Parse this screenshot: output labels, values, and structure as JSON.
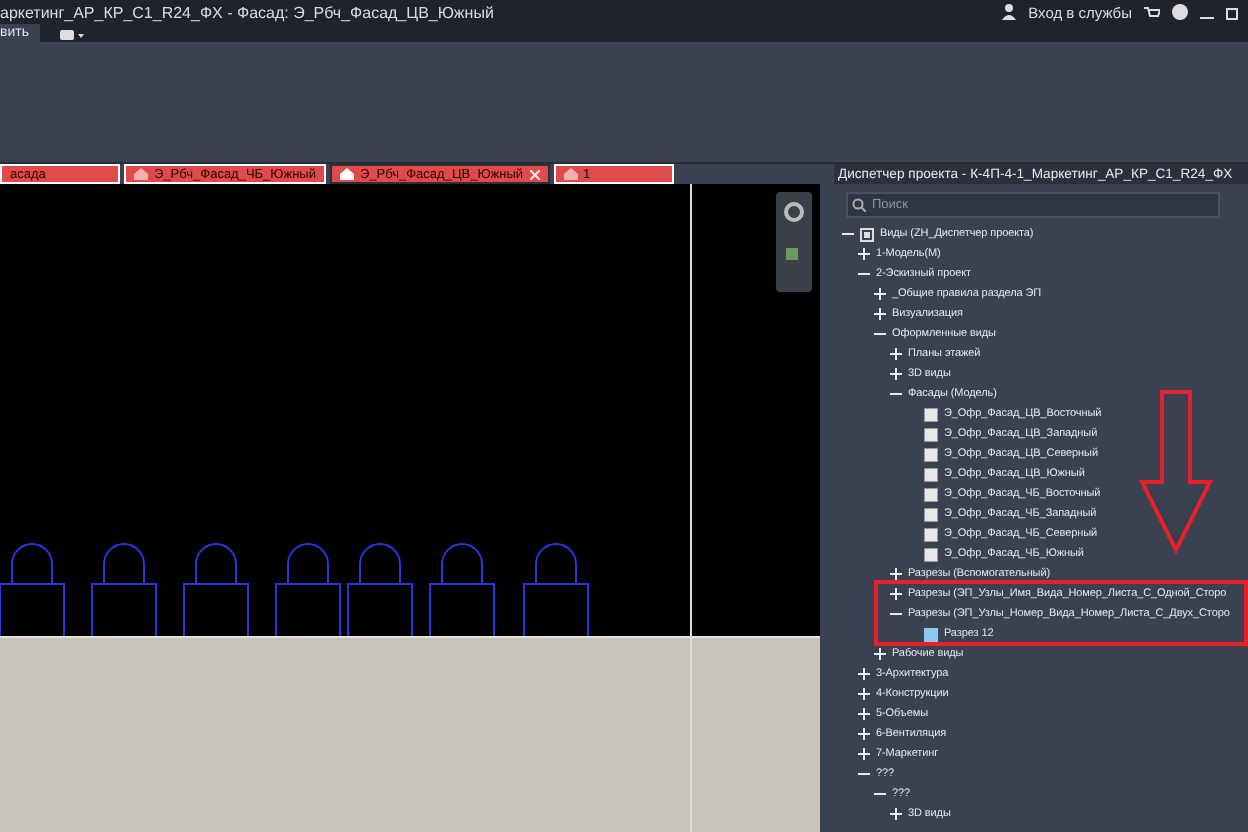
{
  "window": {
    "title": "аркетинг_АР_КР_С1_R24_ФХ - Фасад: Э_Рбч_Фасад_ЦВ_Южный",
    "signin": "Вход в службы"
  },
  "ribbon": {
    "tabs": [
      {
        "label": "вить",
        "selected": true
      }
    ]
  },
  "doc_tabs": [
    {
      "label": "асада",
      "selected": false,
      "icon": false
    },
    {
      "label": "Э_Рбч_Фасад_ЧБ_Южный",
      "selected": false,
      "icon": true
    },
    {
      "label": "Э_Рбч_Фасад_ЦВ_Южный",
      "selected": true,
      "icon": true
    },
    {
      "label": "1",
      "selected": false,
      "icon": true
    }
  ],
  "project_browser": {
    "title": "Диспетчер проекта - К-4П-4-1_Маркетинг_АР_КР_С1_R24_ФХ",
    "search": {
      "placeholder": "Поиск"
    },
    "tree": [
      {
        "kind": "root",
        "label": "Виды (ZH_Диспетчер проекта)",
        "expanded": true,
        "children": [
          {
            "kind": "folder",
            "label": "1-Модель(М)",
            "expanded": false
          },
          {
            "kind": "folder",
            "label": "2-Эскизный проект",
            "expanded": true,
            "children": [
              {
                "kind": "folder",
                "label": "_Общие правила раздела ЭП",
                "expanded": false
              },
              {
                "kind": "folder",
                "label": "Визуализация",
                "expanded": false
              },
              {
                "kind": "folder",
                "label": "Оформленные виды",
                "expanded": true,
                "children": [
                  {
                    "kind": "folder",
                    "label": "Планы этажей",
                    "expanded": false
                  },
                  {
                    "kind": "folder",
                    "label": "3D виды",
                    "expanded": false
                  },
                  {
                    "kind": "folder",
                    "label": "Фасады (Модель)",
                    "expanded": true,
                    "children": [
                      {
                        "kind": "elevation",
                        "label": "Э_Офр_Фасад_ЦВ_Восточный"
                      },
                      {
                        "kind": "elevation",
                        "label": "Э_Офр_Фасад_ЦВ_Западный"
                      },
                      {
                        "kind": "elevation",
                        "label": "Э_Офр_Фасад_ЦВ_Северный"
                      },
                      {
                        "kind": "elevation",
                        "label": "Э_Офр_Фасад_ЦВ_Южный"
                      },
                      {
                        "kind": "elevation",
                        "label": "Э_Офр_Фасад_ЧБ_Восточный"
                      },
                      {
                        "kind": "elevation",
                        "label": "Э_Офр_Фасад_ЧБ_Западный"
                      },
                      {
                        "kind": "elevation",
                        "label": "Э_Офр_Фасад_ЧБ_Северный"
                      },
                      {
                        "kind": "elevation",
                        "label": "Э_Офр_Фасад_ЧБ_Южный"
                      }
                    ]
                  },
                  {
                    "kind": "folder",
                    "label": "Разрезы (Вспомогательный)",
                    "expanded": false
                  },
                  {
                    "kind": "folder",
                    "label": "Разрезы (ЭП_Узлы_Имя_Вида_Номер_Листа_С_Одной_Сторо",
                    "expanded": false
                  },
                  {
                    "kind": "folder",
                    "label": "Разрезы (ЭП_Узлы_Номер_Вида_Номер_Листа_С_Двух_Сторо",
                    "expanded": true,
                    "children": [
                      {
                        "kind": "section",
                        "label": "Разрез 12"
                      }
                    ]
                  }
                ]
              },
              {
                "kind": "folder",
                "label": "Рабочие виды",
                "expanded": false
              }
            ]
          },
          {
            "kind": "folder",
            "label": "3-Архитектура",
            "expanded": false
          },
          {
            "kind": "folder",
            "label": "4-Конструкции",
            "expanded": false
          },
          {
            "kind": "folder",
            "label": "5-Объемы",
            "expanded": false
          },
          {
            "kind": "folder",
            "label": "6-Вентиляция",
            "expanded": false
          },
          {
            "kind": "folder",
            "label": "7-Маркетинг",
            "expanded": false
          },
          {
            "kind": "folder",
            "label": "???",
            "expanded": true,
            "children": [
              {
                "kind": "folder",
                "label": "???",
                "expanded": true,
                "children": [
                  {
                    "kind": "folder",
                    "label": "3D виды",
                    "expanded": false
                  }
                ]
              }
            ]
          }
        ]
      }
    ]
  }
}
